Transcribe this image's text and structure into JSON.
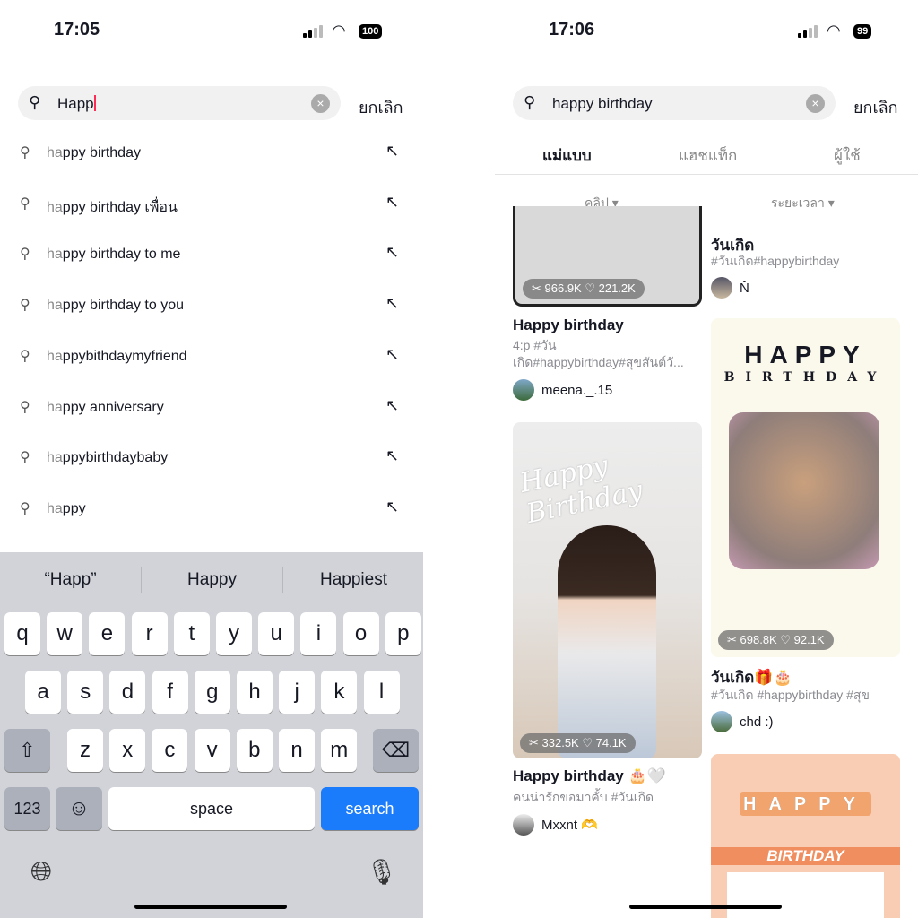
{
  "left": {
    "status": {
      "time": "17:05",
      "battery": "100"
    },
    "search": {
      "typed": "Happ",
      "cancel": "ยกเลิก"
    },
    "suggestions": [
      {
        "match": "ha",
        "rest": "ppy birthday"
      },
      {
        "match": "ha",
        "rest": "ppy birthday เพื่อน"
      },
      {
        "match": "ha",
        "rest": "ppy birthday to me"
      },
      {
        "match": "ha",
        "rest": "ppy birthday to you"
      },
      {
        "match": "ha",
        "rest": "ppybithdaymyfriend"
      },
      {
        "match": "ha",
        "rest": "ppy anniversary"
      },
      {
        "match": "ha",
        "rest": "ppybirthdaybaby"
      },
      {
        "match": "ha",
        "rest": "ppy"
      }
    ],
    "keyboard": {
      "predictions": [
        "“Happ”",
        "Happy",
        "Happiest"
      ],
      "row1": [
        "q",
        "w",
        "e",
        "r",
        "t",
        "y",
        "u",
        "i",
        "o",
        "p"
      ],
      "row2": [
        "a",
        "s",
        "d",
        "f",
        "g",
        "h",
        "j",
        "k",
        "l"
      ],
      "row3": [
        "z",
        "x",
        "c",
        "v",
        "b",
        "n",
        "m"
      ],
      "numbers": "123",
      "space": "space",
      "search": "search"
    }
  },
  "right": {
    "status": {
      "time": "17:06",
      "battery": "99"
    },
    "search": {
      "query": "happy birthday",
      "cancel": "ยกเลิก"
    },
    "tabs": [
      {
        "label": "แม่แบบ",
        "active": true
      },
      {
        "label": "แฮชแท็ก"
      },
      {
        "label": "ผู้ใช้"
      }
    ],
    "filters": [
      "คลิป",
      "ระยะเวลา"
    ],
    "cards": [
      {
        "uses": "966.9K",
        "likes": "221.2K",
        "title": "Happy birthday",
        "desc": "4:p #วัน\nเกิด#happybirthday#สุขสันต์วั...",
        "user": "meena._.15"
      },
      {
        "title": "วันเกิด",
        "desc": "#วันเกิด#happybirthday",
        "user": "Ň"
      },
      {
        "uses": "698.8K",
        "likes": "92.1K",
        "title": "วันเกิด🎁🎂",
        "desc": "#วันเกิด #happybirthday #สุข",
        "user": "chd :)",
        "art": "HAPPY",
        "art2": "BIRTHDAY"
      },
      {
        "uses": "332.5K",
        "likes": "74.1K",
        "title": "Happy birthday 🎂🤍",
        "desc": "คนน่ารักขอมาคั้บ #วันเกิด",
        "user": "Mxxnt 🫶",
        "art": "Happy Birthday"
      },
      {
        "art": "HAPPY",
        "art2": "BIRTHDAY"
      }
    ]
  }
}
